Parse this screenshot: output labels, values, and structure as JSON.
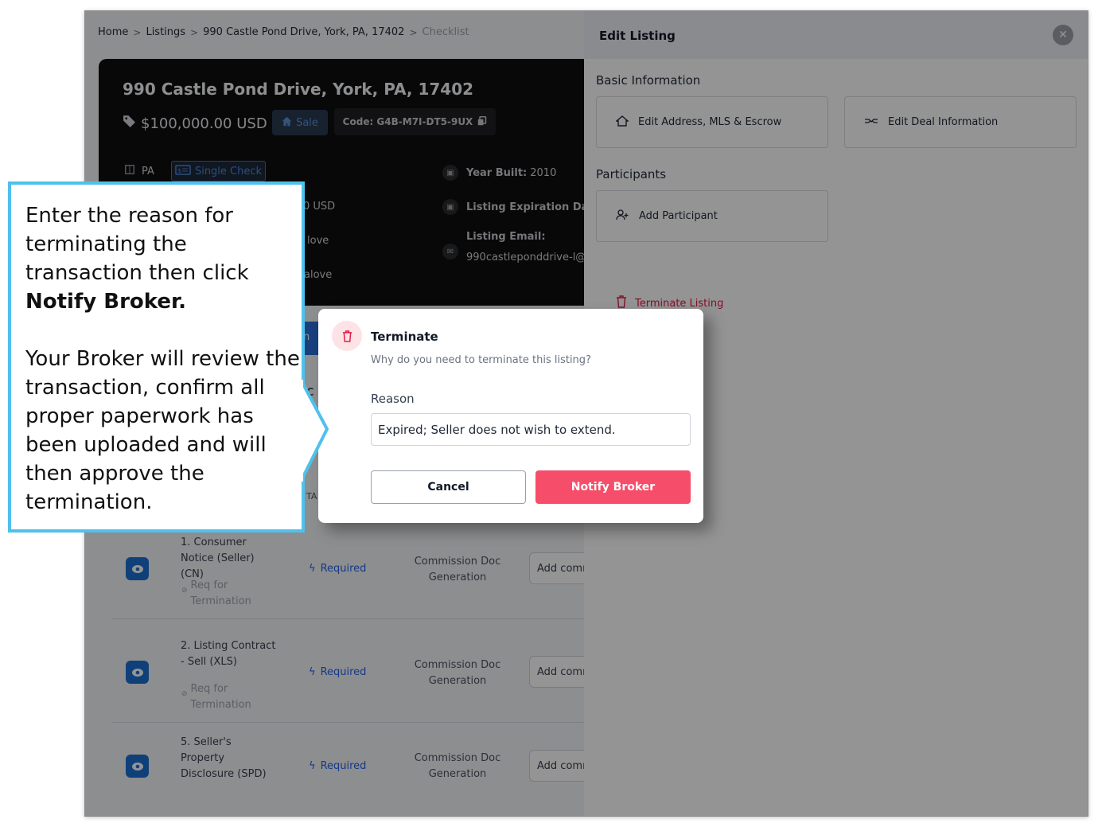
{
  "breadcrumb": {
    "home": "Home",
    "listings": "Listings",
    "address": "990 Castle Pond Drive, York, PA, 17402",
    "current": "Checklist"
  },
  "listing": {
    "title": "990 Castle Pond Drive, York, PA, 17402",
    "price": "$100,000.00 USD",
    "sale_badge": "Sale",
    "code": "Code: G4B-M7I-DT5-9UX",
    "state": "PA",
    "check_type": "Single Check",
    "frag_price": "0 USD",
    "frag_agent1": "love",
    "frag_agent2": "alove",
    "year_built_label": "Year Built:",
    "year_built_value": "2010",
    "expiration_label": "Listing Expiration Date",
    "email_label": "Listing Email:",
    "email_value": "990castleponddrive-l@",
    "frag_tab": "n",
    "frag_col": "C",
    "frag_col2": "TA"
  },
  "checklist": {
    "rows": [
      {
        "name": "1. Consumer Notice (Seller) (CN)",
        "tag": "Req for Termination",
        "status": "Required",
        "type": "Commission Doc Generation",
        "comment_placeholder": "Add comm"
      },
      {
        "name": "2. Listing Contract - Sell (XLS)",
        "tag": "Req for Termination",
        "status": "Required",
        "type": "Commission Doc Generation",
        "comment_placeholder": "Add comm"
      },
      {
        "name": "5. Seller's Property Disclosure (SPD)",
        "tag": "",
        "status": "Required",
        "type": "Commission Doc Generation",
        "comment_placeholder": "Add comm"
      }
    ]
  },
  "panel": {
    "title": "Edit Listing",
    "basic_info_title": "Basic Information",
    "edit_address_label": "Edit Address, MLS & Escrow",
    "edit_deal_label": "Edit Deal Information",
    "participants_title": "Participants",
    "add_participant_label": "Add Participant",
    "terminate_label": "Terminate Listing"
  },
  "modal": {
    "title": "Terminate",
    "subtitle": "Why do you need to terminate this listing?",
    "reason_label": "Reason",
    "reason_value": "Expired; Seller does not wish to extend.",
    "cancel_label": "Cancel",
    "notify_label": "Notify Broker"
  },
  "callout": {
    "line1": "Enter the reason for terminating the transaction then click",
    "line1_bold": "Notify Broker",
    "line1_end": ".",
    "line2": "Your Broker will review the transaction, confirm all proper paperwork has been uploaded and will then approve the termination."
  },
  "colors": {
    "accent": "#f64e6a",
    "callout_border": "#4fc1ec",
    "link_blue": "#2563eb"
  }
}
